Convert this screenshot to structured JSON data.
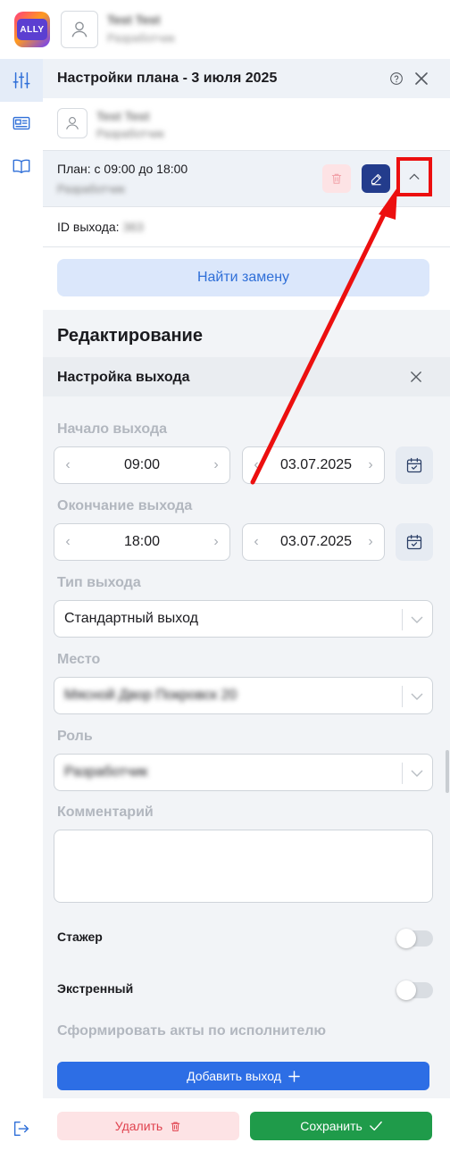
{
  "app": {
    "logo_text": "ALLY",
    "user_name": "Test Test",
    "user_role": "Разработчик"
  },
  "panel": {
    "title": "Настройки плана - 3 июля 2025",
    "user_name": "Test Test",
    "user_role": "Разработчик"
  },
  "plan": {
    "title": "План: с 09:00 до 18:00",
    "role": "Разработчик"
  },
  "exit_id": {
    "label": "ID выхода:",
    "value": "363"
  },
  "find_replacement_label": "Найти замену",
  "edit_section": {
    "title": "Редактирование",
    "subtitle": "Настройка выхода"
  },
  "form": {
    "start_label": "Начало выхода",
    "start_time": "09:00",
    "start_date": "03.07.2025",
    "end_label": "Окончание выхода",
    "end_time": "18:00",
    "end_date": "03.07.2025",
    "type_label": "Тип выхода",
    "type_value": "Стандартный выход",
    "place_label": "Место",
    "place_value": "Мясной Двор Покровск 20",
    "role_label": "Роль",
    "role_value": "Разработчик",
    "comment_label": "Комментарий",
    "comment_value": "",
    "trainee_label": "Стажер",
    "trainee_on": false,
    "emergency_label": "Экстренный",
    "emergency_on": false,
    "acts_label": "Сформировать акты по исполнителю",
    "add_exit_label": "Добавить выход"
  },
  "footer": {
    "delete_label": "Удалить",
    "save_label": "Сохранить"
  },
  "colors": {
    "primary": "#2d6ee5",
    "danger_bg": "#fde3e5",
    "danger_text": "#e0424e",
    "success": "#1f9b4a",
    "edit_btn": "#233c8c",
    "highlight": "#ec0f0f"
  }
}
